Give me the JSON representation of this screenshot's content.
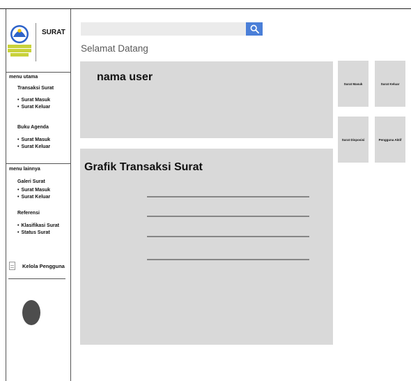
{
  "app": {
    "title": "SURAT"
  },
  "search": {
    "value": "",
    "placeholder": ""
  },
  "header": {
    "welcome": "Selamat Datang"
  },
  "user": {
    "name": "nama user"
  },
  "stats": [
    "Surat Masuk",
    "Surat Keluar",
    "Surat Disposisi",
    "Pengguna Aktif"
  ],
  "sidebar": {
    "menu_utama": {
      "label": "menu utama",
      "transaksi": {
        "label": "Transaksi Surat",
        "items": [
          "Surat Masuk",
          "Surat Keluar"
        ]
      },
      "agenda": {
        "label": "Buku Agenda",
        "items": [
          "Surat Masuk",
          "Surat Keluar"
        ]
      }
    },
    "menu_lainnya": {
      "label": "menu lainnya",
      "galeri": {
        "label": "Galeri Surat",
        "items": [
          "Surat Masuk",
          "Surat Keluar"
        ]
      },
      "referensi": {
        "label": "Referensi",
        "items": [
          "Klasifikasi Surat",
          "Status Surat"
        ]
      }
    },
    "kelola": {
      "label": "Kelola Pengguna"
    }
  },
  "chart": {
    "title": "Grafik Transaksi Surat",
    "gridlines": 4
  },
  "colors": {
    "panel": "#d9d9d9",
    "search_button": "#4a7fd8",
    "avatar": "#4d4d4d"
  }
}
